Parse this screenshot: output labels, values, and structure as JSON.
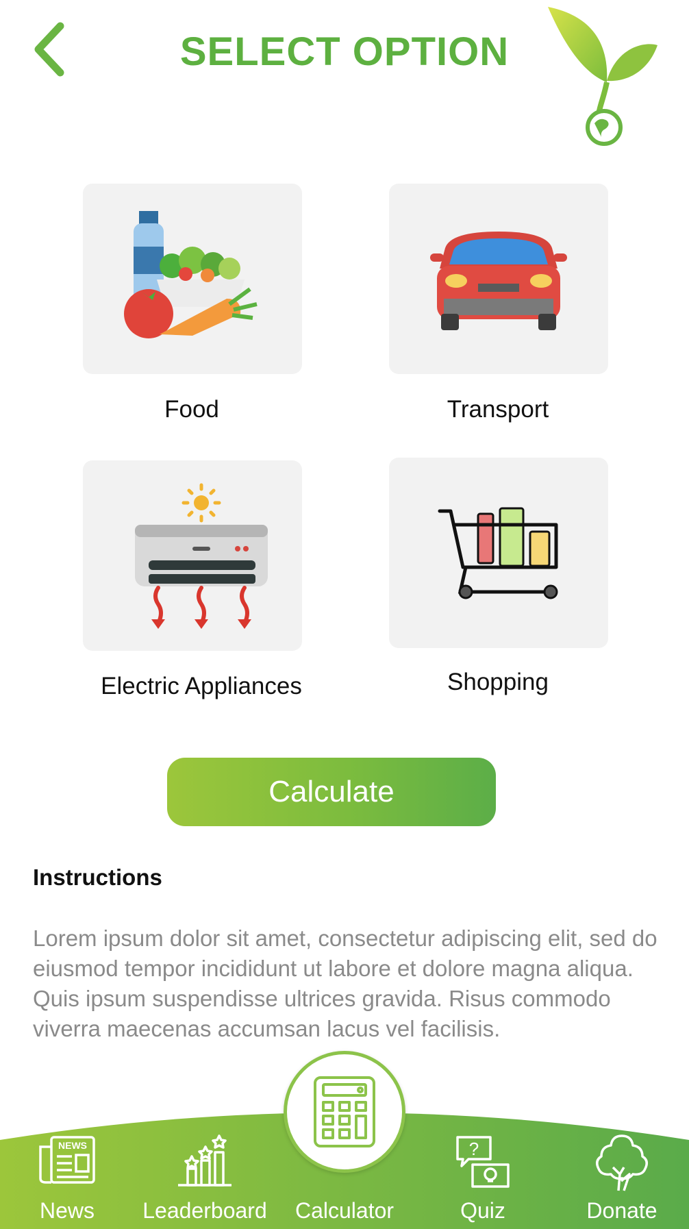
{
  "header": {
    "title": "SELECT OPTION"
  },
  "options": [
    {
      "label": "Food"
    },
    {
      "label": "Transport"
    },
    {
      "label": "Electric Appliances"
    },
    {
      "label": "Shopping"
    }
  ],
  "calculate_label": "Calculate",
  "instructions": {
    "title": "Instructions",
    "body": "Lorem ipsum dolor sit amet, consectetur adipiscing elit, sed do eiusmod tempor incididunt ut labore et dolore magna aliqua. Quis ipsum suspendisse ultrices gravida. Risus commodo viverra maecenas accumsan lacus vel facilisis."
  },
  "nav": [
    {
      "label": "News",
      "icon": "news-icon"
    },
    {
      "label": "Leaderboard",
      "icon": "leaderboard-icon"
    },
    {
      "label": "Calculator",
      "icon": "calculator-icon",
      "active": true
    },
    {
      "label": "Quiz",
      "icon": "quiz-icon"
    },
    {
      "label": "Donate",
      "icon": "tree-icon"
    }
  ],
  "colors": {
    "brand_green": "#5db040",
    "nav_gradient_start": "#9cc63b",
    "nav_gradient_end": "#5aab4a",
    "tile_bg": "#f2f2f2",
    "body_text": "#8a8a8a"
  }
}
